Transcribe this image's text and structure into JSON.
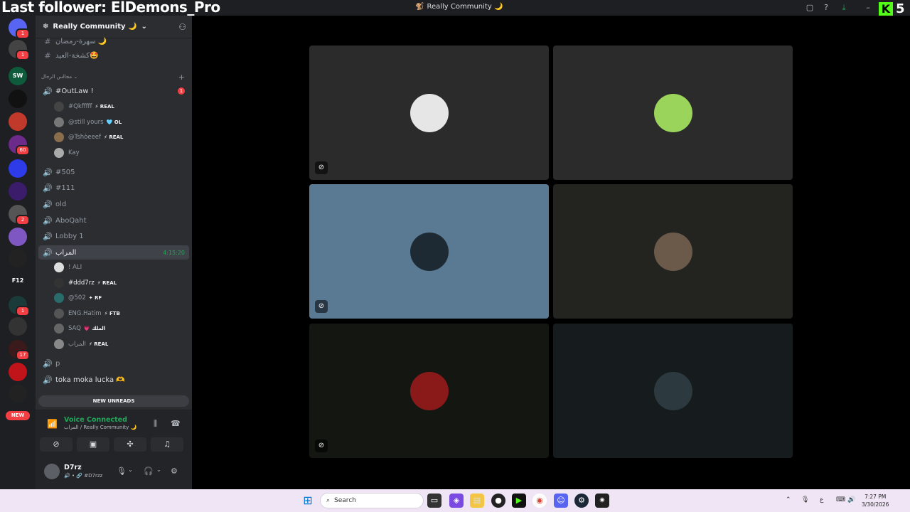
{
  "overlay": {
    "follower_text": "Last follower: ElDemons_Pro",
    "kick_count": "5",
    "kick_logo": "K"
  },
  "window": {
    "title": "Really Community 🌙"
  },
  "guilds": [
    {
      "name": "direct-messages",
      "color": "#5865f2",
      "badge": "1"
    },
    {
      "name": "server-1",
      "color": "#444",
      "badge": "1"
    },
    {
      "name": "server-sw",
      "color": "#0e5b3b",
      "label": "SW"
    },
    {
      "name": "server-3",
      "color": "#111"
    },
    {
      "name": "server-4",
      "color": "#c0392b"
    },
    {
      "name": "server-5",
      "color": "#6c2a8a",
      "badge": "60"
    },
    {
      "name": "server-6",
      "color": "#2d3be8"
    },
    {
      "name": "server-dev",
      "color": "#3a1c6b"
    },
    {
      "name": "server-8",
      "color": "#555",
      "badge": "2"
    },
    {
      "name": "server-9",
      "color": "#7e57c2"
    },
    {
      "name": "server-10",
      "color": "#222"
    },
    {
      "name": "server-f12",
      "color": "#1e1f22",
      "label": "F12"
    },
    {
      "name": "server-12",
      "color": "#1b3b3b",
      "badge": "1"
    },
    {
      "name": "server-13",
      "color": "#333"
    },
    {
      "name": "server-14",
      "color": "#3a1a1a",
      "badge": "17"
    },
    {
      "name": "server-15",
      "color": "#c0141a"
    },
    {
      "name": "server-16",
      "color": "#222"
    }
  ],
  "new_pill": "NEW",
  "server": {
    "name": "Really Community 🌙"
  },
  "channels_top": [
    {
      "name": "سهرة-رمضان 🌙"
    },
    {
      "name": "كشخة-العيد🤩"
    }
  ],
  "category": {
    "name": "مجالس الرجال"
  },
  "voice_channels": [
    {
      "name": "#OutLaw !",
      "mention": "1"
    },
    {
      "name": "#505"
    },
    {
      "name": "#111"
    },
    {
      "name": "old"
    },
    {
      "name": "AboQaht"
    },
    {
      "name": "Lobby 1"
    },
    {
      "name": "المراب",
      "timer": "4:15:20"
    },
    {
      "name": "p"
    },
    {
      "name": "toka moka lucka 🫶"
    }
  ],
  "outlaw_users": [
    {
      "name": "#Qkfffff",
      "tag": "⚡ REAL",
      "avatar": "#444"
    },
    {
      "name": "@still yours",
      "tag": "🩵 OL",
      "avatar": "#777"
    },
    {
      "name": "@Tshòeeef",
      "tag": "⚡ REAL",
      "avatar": "#8a6d4a"
    },
    {
      "name": "Kay",
      "tag": "",
      "avatar": "#aaa"
    }
  ],
  "murab_users": [
    {
      "name": "! ALI",
      "tag": "",
      "avatar": "#ddd"
    },
    {
      "name": "#ddd7rz",
      "tag": "⚡ REAL",
      "avatar": "#333"
    },
    {
      "name": "@502",
      "tag": "✦ RF",
      "avatar": "#2a6b6b"
    },
    {
      "name": "ENG.Hatim",
      "tag": "⚡ FTB",
      "avatar": "#555"
    },
    {
      "name": "SAQ",
      "tag": "💗 الملك",
      "avatar": "#666"
    },
    {
      "name": "المراب",
      "tag": "⚡ REAL",
      "avatar": "#888"
    }
  ],
  "new_unreads": "NEW UNREADS",
  "voice": {
    "status": "Voice Connected",
    "location": "المراب / Really Community 🌙"
  },
  "me": {
    "name": "D7rz",
    "sub": "🔊 • 🔗 #D7rzz"
  },
  "tiles": [
    {
      "bg": "#2b2b2b",
      "avatar": "#e6e6e6"
    },
    {
      "bg": "#2b2b2b",
      "avatar": "#9ad45a"
    },
    {
      "bg": "#5a7a94",
      "avatar": "#1e2a33"
    },
    {
      "bg": "#232320",
      "avatar": "#6b5a4a"
    },
    {
      "bg": "#131611",
      "avatar": "#8a1a1a"
    },
    {
      "bg": "#161b1d",
      "avatar": "#2c3a3f"
    }
  ],
  "taskbar": {
    "search_label": "Search",
    "time": "7:27 PM",
    "date": "3/30/2026"
  }
}
